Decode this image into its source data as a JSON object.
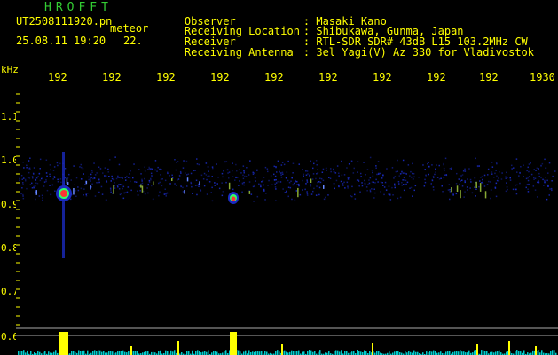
{
  "header": {
    "app_title": "HROFFT",
    "file_name": "UT2508111920.pn",
    "file_suffix": "meteor",
    "date_time": "25.08.11 19:20",
    "time_extra": "22.",
    "info": [
      {
        "key": "Observer",
        "value": ": Masaki Kano"
      },
      {
        "key": "Receiving Location",
        "value": ": Shibukawa, Gunma, Japan"
      },
      {
        "key": "Receiver",
        "value": ": RTL-SDR SDR# 43dB L15 103.2MHz CW"
      },
      {
        "key": "Receiving Antenna",
        "value": ": 3el Yagi(V) Az 330 for Vladivostok"
      }
    ]
  },
  "axes": {
    "unit": "kHz",
    "x_ticks": [
      "192",
      "192",
      "192",
      "192",
      "192",
      "192",
      "192",
      "192",
      "192",
      "1930"
    ],
    "y_ticks": [
      "1.1",
      "1.0",
      "0.9",
      "0.8",
      "0.7",
      "0.6"
    ]
  },
  "colors": {
    "text": "#ffff00",
    "title": "#33cc33",
    "axis": "#ffff00",
    "background": "#000000",
    "noise": "#1a2bbf",
    "signal_hot": "#ff3333",
    "signal_warm": "#33ff66",
    "histogram": "#00cccc"
  }
}
